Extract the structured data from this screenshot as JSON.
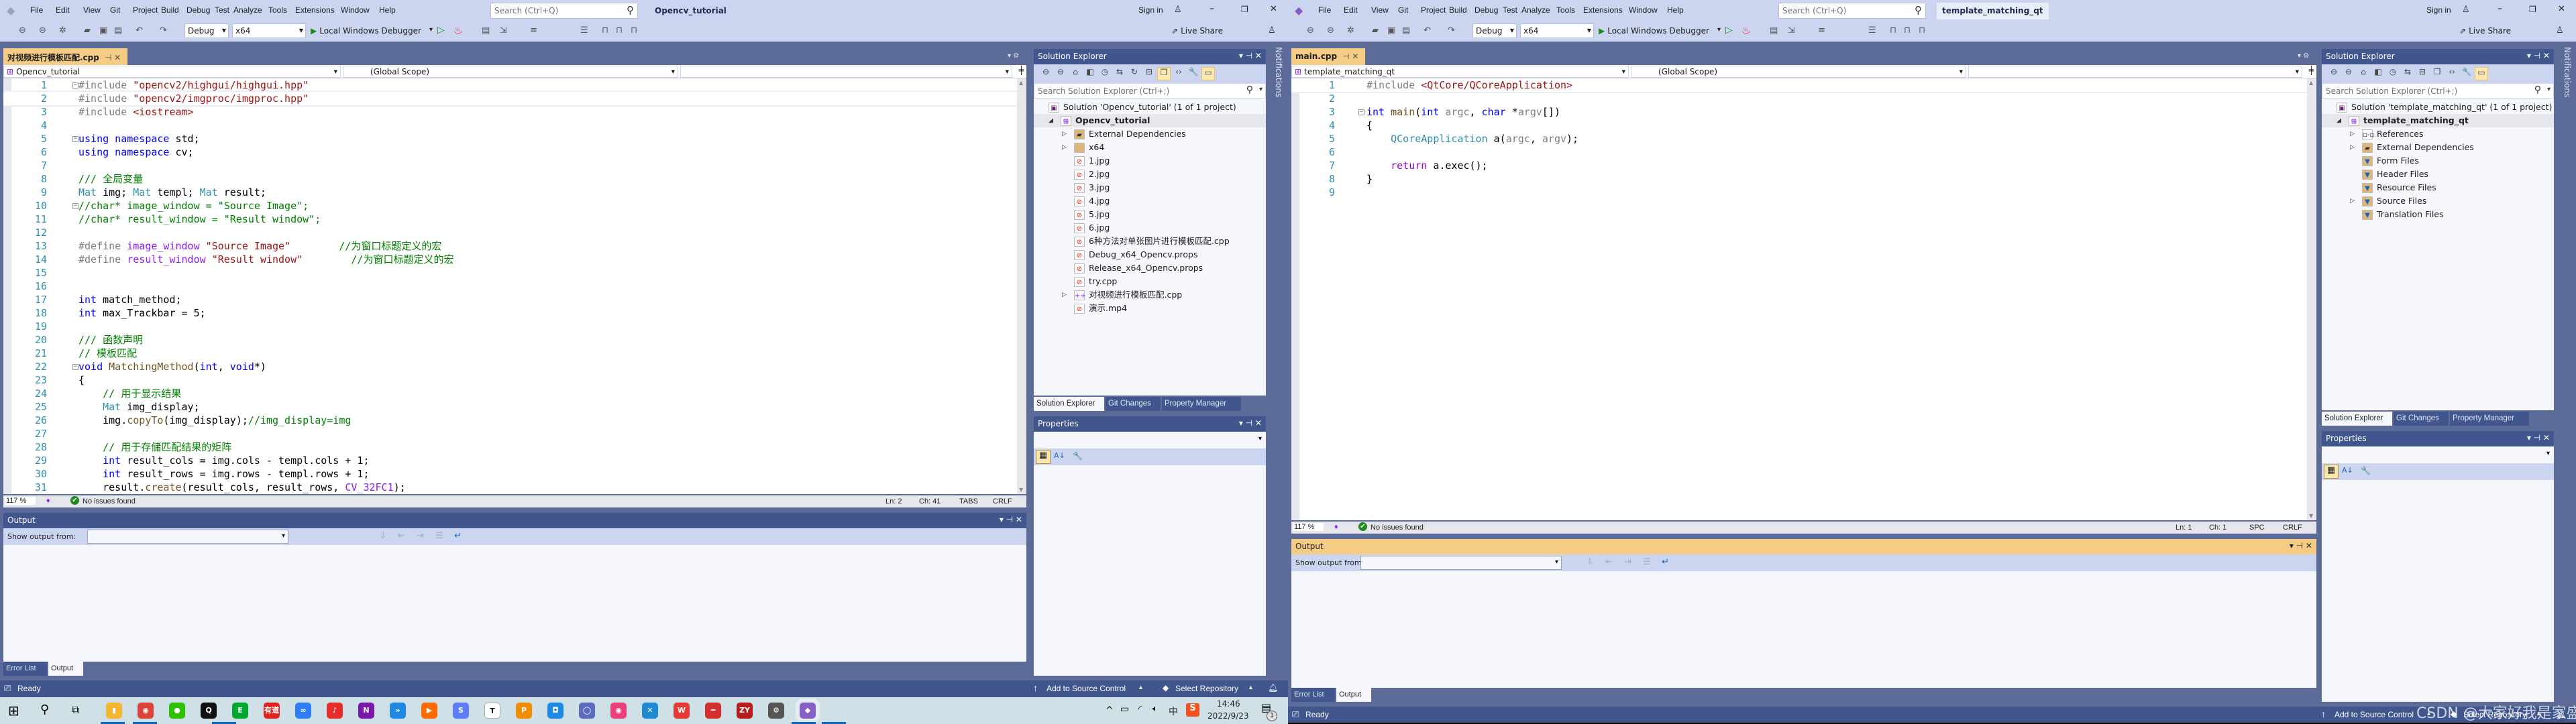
{
  "windows": [
    {
      "active": false,
      "menu": [
        "File",
        "Edit",
        "View",
        "Git",
        "Project",
        "Build",
        "Debug",
        "Test",
        "Analyze",
        "Tools",
        "Extensions",
        "Window",
        "Help"
      ],
      "search_placeholder": "Search (Ctrl+Q)",
      "title": "Opencv_tutorial",
      "sign_in": "Sign in",
      "toolbar": {
        "config": "Debug",
        "platform": "x64",
        "debugger": "Local Windows Debugger",
        "live_share": "Live Share"
      },
      "editor": {
        "tab": "对视频进行模板匹配.cpp",
        "project_scope": "Opencv_tutorial",
        "scope": "(Global Scope)",
        "current_line": 2,
        "lines": [
          {
            "fold": "minus",
            "tokens": [
              [
                "p",
                "#include "
              ],
              [
                "s",
                "\"opencv2/highgui/highgui.hpp\""
              ]
            ]
          },
          {
            "tokens": [
              [
                "p",
                "#include "
              ],
              [
                "s",
                "\"opencv2/imgproc/imgproc.hpp\""
              ]
            ]
          },
          {
            "tokens": [
              [
                "p",
                "#include "
              ],
              [
                "s",
                "<iostream>"
              ]
            ]
          },
          {
            "tokens": []
          },
          {
            "fold": "minus",
            "tokens": [
              [
                "k",
                "using namespace "
              ],
              [
                "n",
                "std;"
              ]
            ]
          },
          {
            "tokens": [
              [
                "k",
                "using namespace "
              ],
              [
                "n",
                "cv;"
              ]
            ]
          },
          {
            "tokens": []
          },
          {
            "tokens": [
              [
                "c",
                "/// 全局变量"
              ]
            ]
          },
          {
            "tokens": [
              [
                "t",
                "Mat "
              ],
              [
                "n",
                "img; "
              ],
              [
                "t",
                "Mat "
              ],
              [
                "n",
                "templ; "
              ],
              [
                "t",
                "Mat "
              ],
              [
                "n",
                "result;"
              ]
            ]
          },
          {
            "fold": "minus",
            "tokens": [
              [
                "c",
                "//char* image_window = \"Source Image\";"
              ]
            ]
          },
          {
            "tokens": [
              [
                "c",
                "//char* result_window = \"Result window\";"
              ]
            ]
          },
          {
            "tokens": []
          },
          {
            "tokens": [
              [
                "p",
                "#define "
              ],
              [
                "m",
                "image_window "
              ],
              [
                "s",
                "\"Source Image\""
              ],
              [
                "c",
                "        //为窗口标题定义的宏"
              ]
            ]
          },
          {
            "tokens": [
              [
                "p",
                "#define "
              ],
              [
                "m",
                "result_window "
              ],
              [
                "s",
                "\"Result window\""
              ],
              [
                "c",
                "        //为窗口标题定义的宏"
              ]
            ]
          },
          {
            "tokens": []
          },
          {
            "tokens": []
          },
          {
            "tokens": [
              [
                "k",
                "int "
              ],
              [
                "n",
                "match_method;"
              ]
            ]
          },
          {
            "tokens": [
              [
                "k",
                "int "
              ],
              [
                "n",
                "max_Trackbar = 5;"
              ]
            ]
          },
          {
            "tokens": []
          },
          {
            "tokens": [
              [
                "c",
                "/// 函数声明"
              ]
            ]
          },
          {
            "tokens": [
              [
                "c",
                "// 模板匹配"
              ]
            ]
          },
          {
            "fold": "minus",
            "tokens": [
              [
                "k",
                "void "
              ],
              [
                "f",
                "MatchingMethod"
              ],
              [
                "n",
                "("
              ],
              [
                "k",
                "int"
              ],
              [
                "n",
                ", "
              ],
              [
                "k",
                "void"
              ],
              [
                "n",
                "*)"
              ]
            ]
          },
          {
            "tokens": [
              [
                "n",
                "{"
              ]
            ]
          },
          {
            "tokens": [
              [
                "n",
                "    "
              ],
              [
                "c",
                "// 用于显示结果"
              ]
            ]
          },
          {
            "tokens": [
              [
                "n",
                "    "
              ],
              [
                "t",
                "Mat "
              ],
              [
                "n",
                "img_display;"
              ]
            ]
          },
          {
            "tokens": [
              [
                "n",
                "    img."
              ],
              [
                "f",
                "copyTo"
              ],
              [
                "n",
                "(img_display);"
              ],
              [
                "c",
                "//img_display=img"
              ]
            ]
          },
          {
            "tokens": []
          },
          {
            "tokens": [
              [
                "n",
                "    "
              ],
              [
                "c",
                "// 用于存储匹配结果的矩阵"
              ]
            ]
          },
          {
            "tokens": [
              [
                "n",
                "    "
              ],
              [
                "k",
                "int "
              ],
              [
                "n",
                "result_cols = img.cols - templ.cols + 1;"
              ]
            ]
          },
          {
            "tokens": [
              [
                "n",
                "    "
              ],
              [
                "k",
                "int "
              ],
              [
                "n",
                "result_rows = img.rows - templ.rows + 1;"
              ]
            ]
          },
          {
            "tokens": [
              [
                "n",
                "    result."
              ],
              [
                "f",
                "create"
              ],
              [
                "n",
                "(result_cols, result_rows, "
              ],
              [
                "m",
                "CV_32FC1"
              ],
              [
                "n",
                ");"
              ]
            ]
          }
        ],
        "zoom": "117 %",
        "issues": "No issues found",
        "ln": "Ln: 2",
        "ch": "Ch: 41",
        "indent": "TABS",
        "eol": "CRLF"
      },
      "output": {
        "title": "Output",
        "active": false,
        "show_from": "Show output from:",
        "bottom_tabs": [
          "Error List",
          "Output"
        ]
      },
      "solution_explorer": {
        "title": "Solution Explorer",
        "search_placeholder": "Search Solution Explorer (Ctrl+;)",
        "tree": [
          {
            "label": "Solution 'Opencv_tutorial' (1 of 1 project)",
            "level": 0,
            "icon": "solution-icon",
            "expander": "none"
          },
          {
            "label": "Opencv_tutorial",
            "level": 0,
            "icon": "cpp-project-icon",
            "expander": "expanded",
            "bold": true
          },
          {
            "label": "External Dependencies",
            "level": 1,
            "icon": "external-deps-folder-icon",
            "expander": "collapsed"
          },
          {
            "label": "x64",
            "level": 1,
            "icon": "folder-icon",
            "expander": "collapsed"
          },
          {
            "label": "1.jpg",
            "level": 1,
            "icon": "excluded-file-icon"
          },
          {
            "label": "2.jpg",
            "level": 1,
            "icon": "excluded-file-icon"
          },
          {
            "label": "3.jpg",
            "level": 1,
            "icon": "excluded-file-icon"
          },
          {
            "label": "4.jpg",
            "level": 1,
            "icon": "excluded-file-icon"
          },
          {
            "label": "5.jpg",
            "level": 1,
            "icon": "excluded-file-icon"
          },
          {
            "label": "6.jpg",
            "level": 1,
            "icon": "excluded-file-icon"
          },
          {
            "label": "6种方法对单张图片进行模板匹配.cpp",
            "level": 1,
            "icon": "excluded-file-icon"
          },
          {
            "label": "Debug_x64_Opencv.props",
            "level": 1,
            "icon": "excluded-file-icon"
          },
          {
            "label": "Release_x64_Opencv.props",
            "level": 1,
            "icon": "excluded-file-icon"
          },
          {
            "label": "try.cpp",
            "level": 1,
            "icon": "excluded-file-icon"
          },
          {
            "label": "对视频进行模板匹配.cpp",
            "level": 1,
            "icon": "cpp-file-icon",
            "expander": "collapsed"
          },
          {
            "label": "演示.mp4",
            "level": 1,
            "icon": "excluded-file-icon"
          }
        ],
        "tabs": [
          "Solution Explorer",
          "Git Changes",
          "Property Manager"
        ]
      },
      "properties": {
        "title": "Properties"
      },
      "notifications": "Notifications",
      "status": {
        "ready": "Ready",
        "add_source": "Add to Source Control",
        "select_repo": "Select Repository"
      }
    },
    {
      "active": true,
      "menu": [
        "File",
        "Edit",
        "View",
        "Git",
        "Project",
        "Build",
        "Debug",
        "Test",
        "Analyze",
        "Tools",
        "Extensions",
        "Window",
        "Help"
      ],
      "search_placeholder": "Search (Ctrl+Q)",
      "title": "template_matching_qt",
      "sign_in": "Sign in",
      "toolbar": {
        "config": "Debug",
        "platform": "x64",
        "debugger": "Local Windows Debugger",
        "live_share": "Live Share"
      },
      "editor": {
        "tab": "main.cpp",
        "project_scope": "template_matching_qt",
        "scope": "(Global Scope)",
        "current_line": 1,
        "lines": [
          {
            "tokens": [
              [
                "p",
                "#include "
              ],
              [
                "s",
                "<QtCore/QCoreApplication>"
              ]
            ]
          },
          {
            "tokens": []
          },
          {
            "fold": "minus",
            "tokens": [
              [
                "k",
                "int "
              ],
              [
                "f",
                "main"
              ],
              [
                "n",
                "("
              ],
              [
                "k",
                "int "
              ],
              [
                "v",
                "argc"
              ],
              [
                "n",
                ", "
              ],
              [
                "k",
                "char "
              ],
              [
                "n",
                "*"
              ],
              [
                "v",
                "argv"
              ],
              [
                "n",
                "[])"
              ]
            ]
          },
          {
            "tokens": [
              [
                "n",
                "{"
              ]
            ]
          },
          {
            "tokens": [
              [
                "n",
                "    "
              ],
              [
                "t",
                "QCoreApplication "
              ],
              [
                "n",
                "a("
              ],
              [
                "v",
                "argc"
              ],
              [
                "n",
                ", "
              ],
              [
                "v",
                "argv"
              ],
              [
                "n",
                ");"
              ]
            ]
          },
          {
            "tokens": []
          },
          {
            "tokens": [
              [
                "n",
                "    "
              ],
              [
                "r",
                "return "
              ],
              [
                "n",
                "a.exec();"
              ]
            ]
          },
          {
            "tokens": [
              [
                "n",
                "}"
              ]
            ]
          },
          {
            "tokens": []
          }
        ],
        "zoom": "117 %",
        "issues": "No issues found",
        "ln": "Ln: 1",
        "ch": "Ch: 1",
        "indent": "SPC",
        "eol": "CRLF"
      },
      "output": {
        "title": "Output",
        "active": true,
        "show_from": "Show output from:",
        "bottom_tabs": [
          "Error List",
          "Output"
        ]
      },
      "solution_explorer": {
        "title": "Solution Explorer",
        "search_placeholder": "Search Solution Explorer (Ctrl+;)",
        "tree": [
          {
            "label": "Solution 'template_matching_qt' (1 of 1 project)",
            "level": 0,
            "icon": "solution-icon",
            "expander": "none"
          },
          {
            "label": "template_matching_qt",
            "level": 0,
            "icon": "cpp-project-icon",
            "expander": "expanded",
            "bold": true
          },
          {
            "label": "References",
            "level": 1,
            "icon": "references-icon",
            "expander": "collapsed"
          },
          {
            "label": "External Dependencies",
            "level": 1,
            "icon": "external-deps-folder-icon",
            "expander": "collapsed"
          },
          {
            "label": "Form Files",
            "level": 1,
            "icon": "filter-folder-icon"
          },
          {
            "label": "Header Files",
            "level": 1,
            "icon": "filter-folder-icon"
          },
          {
            "label": "Resource Files",
            "level": 1,
            "icon": "filter-folder-icon"
          },
          {
            "label": "Source Files",
            "level": 1,
            "icon": "filter-folder-icon",
            "expander": "collapsed"
          },
          {
            "label": "Translation Files",
            "level": 1,
            "icon": "filter-folder-icon"
          }
        ],
        "tabs": [
          "Solution Explorer",
          "Git Changes",
          "Property Manager"
        ]
      },
      "properties": {
        "title": "Properties"
      },
      "notifications": "Notifications",
      "status": {
        "ready": "Ready",
        "add_source": "Add to Source Control",
        "select_repo": "Select Repository"
      }
    }
  ],
  "taskbar": {
    "apps": [
      {
        "name": "file-explorer",
        "glyph": "▮",
        "color": "#f2b72f"
      },
      {
        "name": "chrome",
        "glyph": "◉",
        "color": "#db4437"
      },
      {
        "name": "wechat",
        "glyph": "●",
        "color": "#2dc100"
      },
      {
        "name": "qq",
        "glyph": "Q",
        "color": "#111111"
      },
      {
        "name": "evernote",
        "glyph": "E",
        "color": "#00a82d"
      },
      {
        "name": "youdao",
        "glyph": "有道",
        "color": "#e0221d"
      },
      {
        "name": "baidu-netdisk",
        "glyph": "∞",
        "color": "#2e7cf6"
      },
      {
        "name": "netease-music",
        "glyph": "♪",
        "color": "#e72d2c"
      },
      {
        "name": "onenote",
        "glyph": "N",
        "color": "#7719aa"
      },
      {
        "name": "teambition",
        "glyph": "»",
        "color": "#1e88e5"
      },
      {
        "name": "orange-app",
        "glyph": "▶",
        "color": "#ff6a00"
      },
      {
        "name": "blue-s-app",
        "glyph": "S",
        "color": "#5c7cfa"
      },
      {
        "name": "typora",
        "glyph": "T",
        "color": "#ffffff"
      },
      {
        "name": "search-tool",
        "glyph": "P",
        "color": "#f08c00"
      },
      {
        "name": "blue-doc-app",
        "glyph": "◘",
        "color": "#1e88e5"
      },
      {
        "name": "circle-app",
        "glyph": "◯",
        "color": "#5c6bc0"
      },
      {
        "name": "pink-app",
        "glyph": "◉",
        "color": "#ec407a"
      },
      {
        "name": "vscode",
        "glyph": "✕",
        "color": "#1f8ad2"
      },
      {
        "name": "wps",
        "glyph": "W",
        "color": "#e53935"
      },
      {
        "name": "red-app",
        "glyph": "━",
        "color": "#d32f2f"
      },
      {
        "name": "zy-app",
        "glyph": "ZY",
        "color": "#b71c1c"
      },
      {
        "name": "settings",
        "glyph": "⚙",
        "color": "#555555"
      },
      {
        "name": "visual-studio",
        "glyph": "◆",
        "color": "#865fc5"
      }
    ],
    "ime": "中",
    "time": "14:46",
    "date": "2022/9/23",
    "notification_count": "1"
  },
  "watermark": "CSDN @大家好我是家盛",
  "colors": {
    "accent_tab": "#f5cc84",
    "chrome": "#ccd5f0",
    "frame": "#5d6b99",
    "panel_header": "#40568d"
  }
}
